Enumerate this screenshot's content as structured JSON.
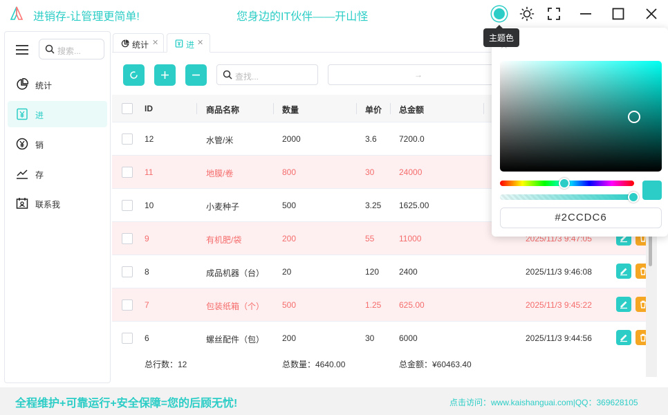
{
  "app": {
    "title": "进销存-让管理更简单!",
    "slogan": "您身边的IT伙伴——开山怪",
    "theme_tooltip": "主题色"
  },
  "sidebar": {
    "search_placeholder": "搜索...",
    "items": [
      {
        "label": "统计",
        "icon": "pie-chart-icon"
      },
      {
        "label": "进",
        "icon": "yen-box-icon"
      },
      {
        "label": "销",
        "icon": "yen-circle-icon"
      },
      {
        "label": "存",
        "icon": "trend-line-icon"
      },
      {
        "label": "联系我",
        "icon": "contact-card-icon"
      }
    ]
  },
  "tabs": [
    {
      "label": "统计",
      "icon": "pie-chart-icon"
    },
    {
      "label": "进",
      "icon": "yen-box-icon"
    }
  ],
  "toolbar": {
    "search_placeholder": "查找...",
    "date_separator": "→"
  },
  "table": {
    "headers": [
      "ID",
      "商品名称",
      "数量",
      "单价",
      "总金额"
    ],
    "rows": [
      {
        "id": "12",
        "name": "水管/米",
        "qty": "2000",
        "price": "3.6",
        "total": "7200.0",
        "time": "",
        "highlight": false
      },
      {
        "id": "11",
        "name": "地膜/卷",
        "qty": "800",
        "price": "30",
        "total": "24000",
        "time": "",
        "highlight": true
      },
      {
        "id": "10",
        "name": "小麦种子",
        "qty": "500",
        "price": "3.25",
        "total": "1625.00",
        "time": "",
        "highlight": false
      },
      {
        "id": "9",
        "name": "有机肥/袋",
        "qty": "200",
        "price": "55",
        "total": "11000",
        "time": "2025/11/3 9:47:05",
        "highlight": true
      },
      {
        "id": "8",
        "name": "成品机器（台）",
        "qty": "20",
        "price": "120",
        "total": "2400",
        "time": "2025/11/3 9:46:08",
        "highlight": false
      },
      {
        "id": "7",
        "name": "包装纸箱（个）",
        "qty": "500",
        "price": "1.25",
        "total": "625.00",
        "time": "2025/11/3 9:45:22",
        "highlight": true
      },
      {
        "id": "6",
        "name": "螺丝配件（包）",
        "qty": "200",
        "price": "30",
        "total": "6000",
        "time": "2025/11/3 9:44:56",
        "highlight": false
      }
    ],
    "footer": {
      "row_count": "总行数：12",
      "total_qty": "总数量：4640.00",
      "total_amount": "总金额：¥60463.40"
    }
  },
  "color_picker": {
    "hex": "#2CCDC6"
  },
  "bottom": {
    "left": "全程维护+可靠运行+安全保障=您的后顾无忧!",
    "right": "点击访问：www.kaishanguai.com|QQ：369628105"
  },
  "colors": {
    "accent": "#2CCDC6",
    "danger": "#f56c6c",
    "warning": "#f5a623"
  }
}
